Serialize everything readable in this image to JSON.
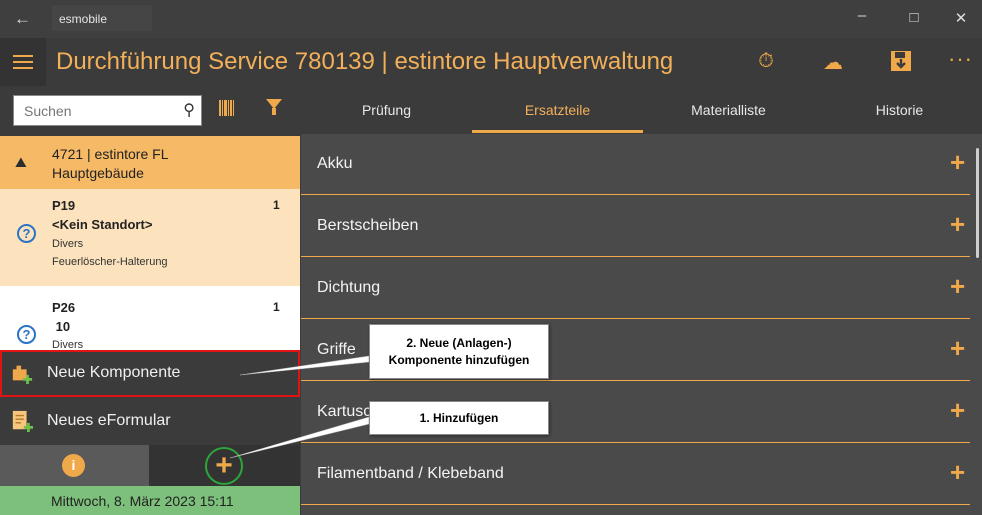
{
  "window": {
    "app_name": "esmobile",
    "back_icon": "arrow-left-icon",
    "controls": [
      "minimize-icon",
      "maximize-icon",
      "close-icon"
    ]
  },
  "header": {
    "title": "Durchführung Service 780139  |  estintore Hauptverwaltung",
    "icons": [
      "timer-icon",
      "cloud-sync-icon",
      "save-download-icon",
      "more-icon"
    ],
    "accent": "#f0a94a"
  },
  "search": {
    "placeholder": "Suchen"
  },
  "site": {
    "line1": "4721  |  estintore FL",
    "line2": "Hauptgebäude"
  },
  "items": [
    {
      "id": "P19",
      "count": "1",
      "location": "<Kein Standort>",
      "category": "Divers",
      "description": "Feuerlöscher-Halterung"
    },
    {
      "id": "P26",
      "count": "1",
      "location": " 10",
      "category": "Divers"
    }
  ],
  "menu": {
    "new_component": "Neue Komponente",
    "new_eform": "Neues eFormular"
  },
  "status": {
    "datetime": "Mittwoch, 8. März 2023 15:11"
  },
  "tabs": {
    "items": [
      "Prüfung",
      "Ersatzteile",
      "Materialliste",
      "Historie"
    ],
    "active_index": 1
  },
  "categories": [
    "Akku",
    "Berstscheiben",
    "Dichtung",
    "Griffe",
    "Kartuschen",
    "Filamentband / Klebeband"
  ],
  "callouts": {
    "step2_line1": "2. Neue (Anlagen-)",
    "step2_line2": "Komponente hinzufügen",
    "step1": "1. Hinzufügen"
  },
  "colors": {
    "site_bg": "#f6b966",
    "selected_bg": "#fde3bd",
    "status_bg": "#7dc07b",
    "highlight_border": "#e01414"
  }
}
